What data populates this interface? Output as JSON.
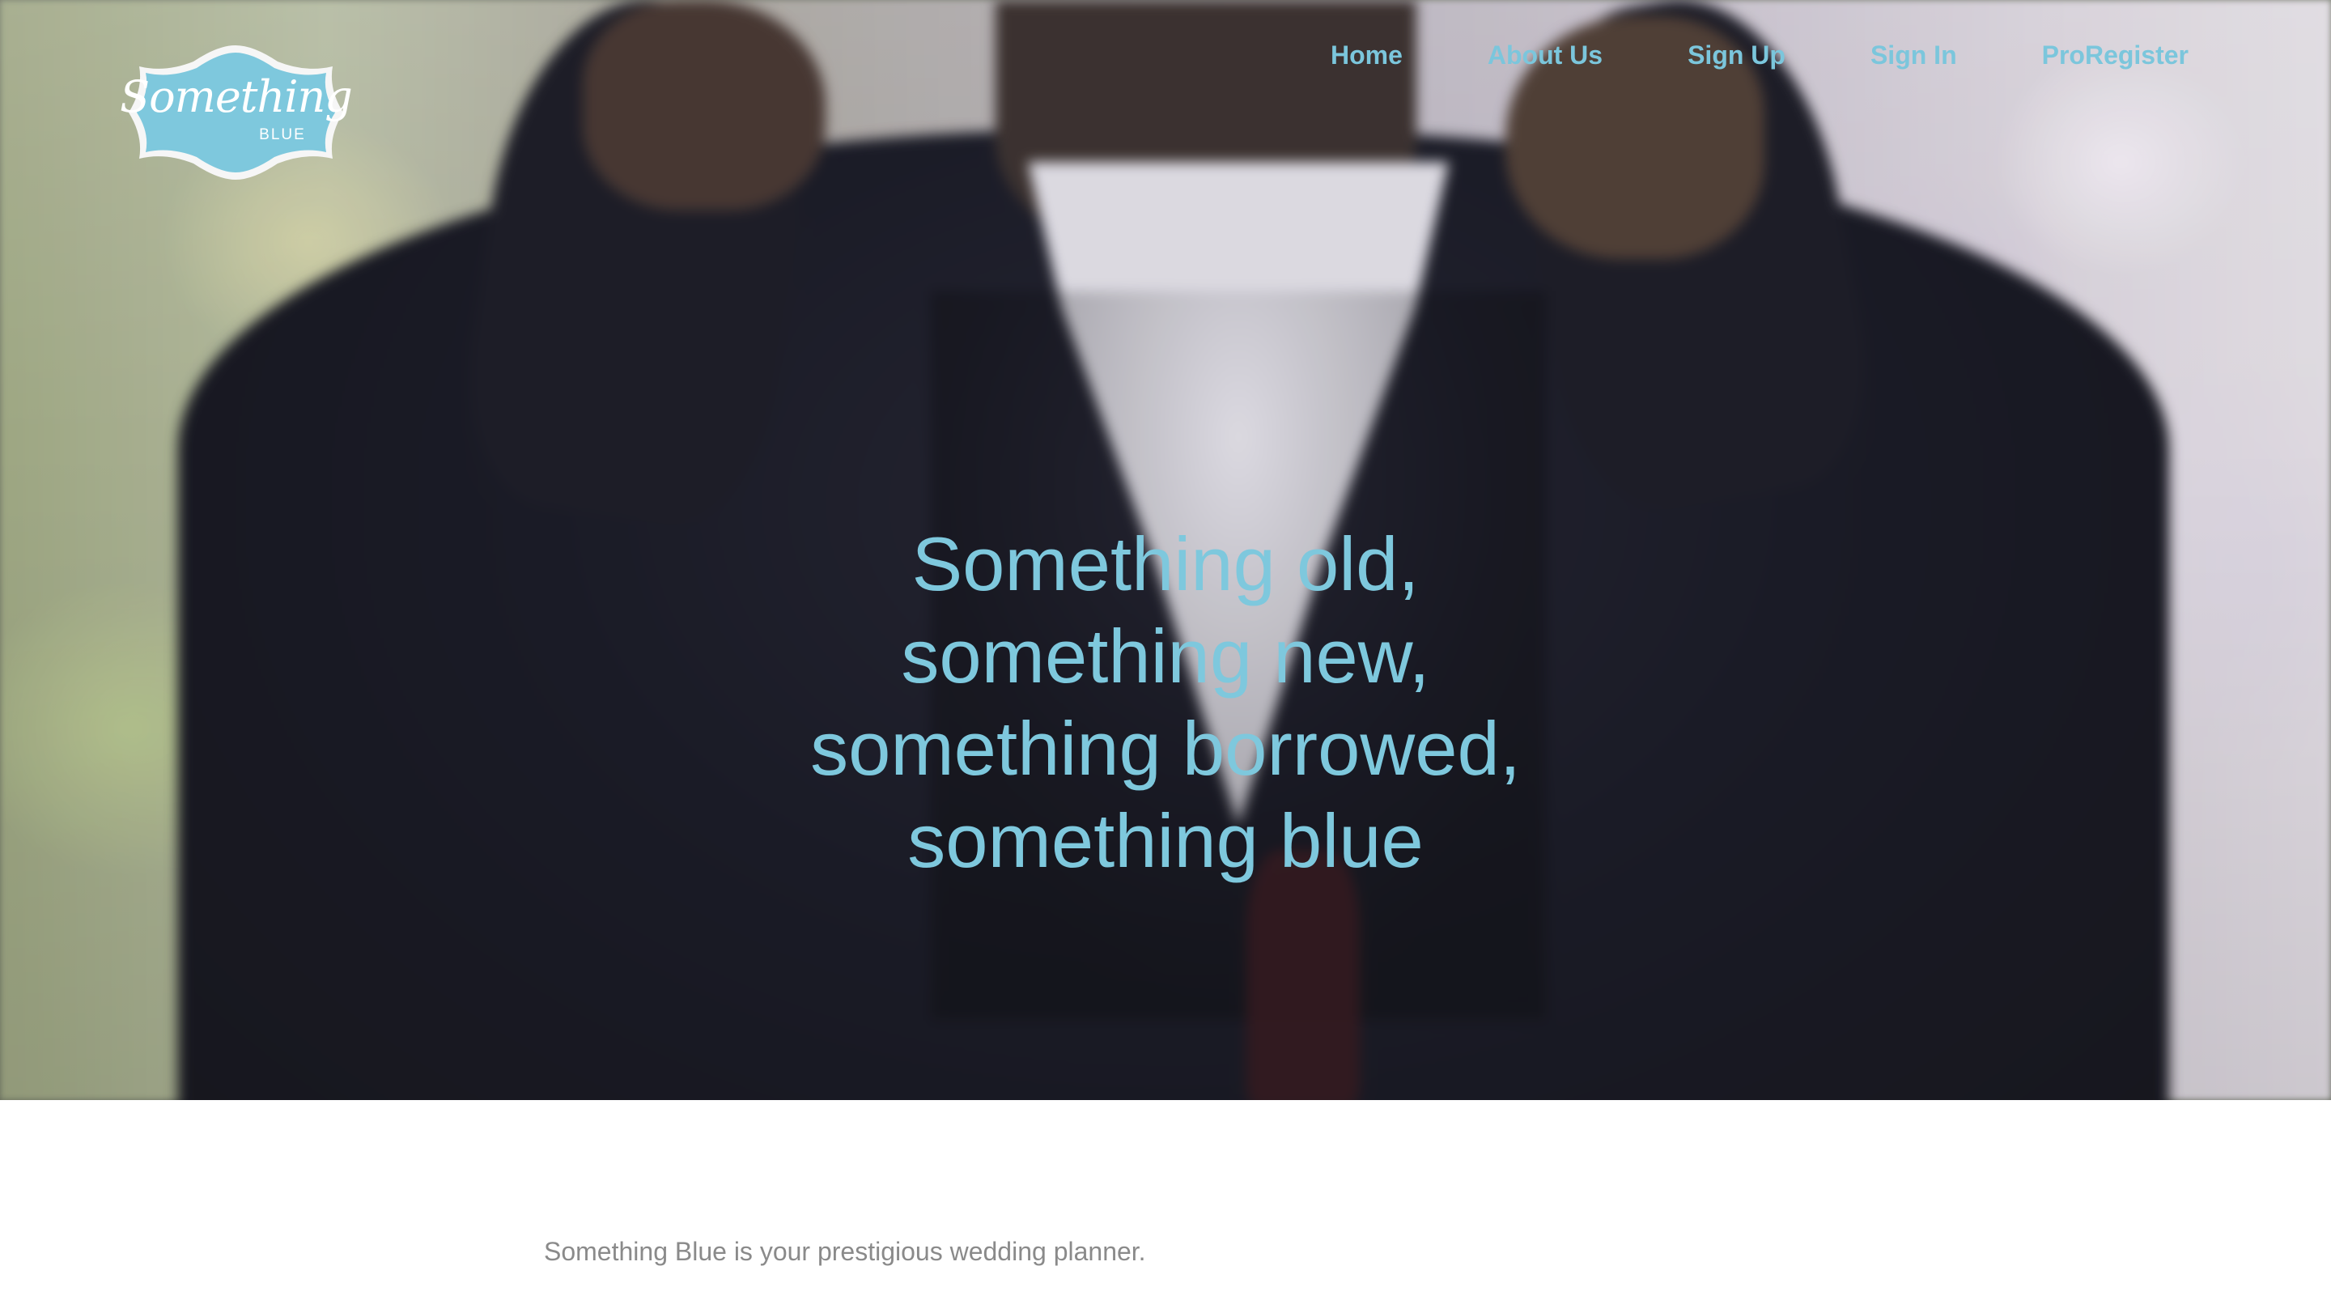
{
  "brand": {
    "logo_script": "Something",
    "logo_sub": "BLUE",
    "logo_color": "#7ec8dd"
  },
  "nav": {
    "items": [
      {
        "label": "Home"
      },
      {
        "label": "About Us"
      },
      {
        "label": "Sign Up"
      },
      {
        "label": "Sign In"
      },
      {
        "label": "ProRegister"
      }
    ],
    "color": "#7bc6dc"
  },
  "hero": {
    "lines": [
      "Something old,",
      "something new,",
      "something borrowed,",
      "something blue"
    ],
    "text_color": "#7ec8dd"
  },
  "intro": {
    "text": "Something Blue is your prestigious wedding planner.",
    "text_color": "#8a8a8a"
  }
}
